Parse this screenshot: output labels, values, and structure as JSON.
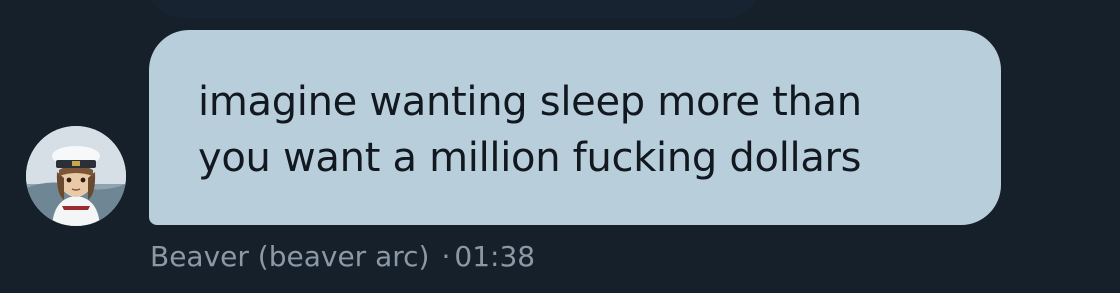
{
  "message": {
    "text": "imagine wanting sleep more than\nyou want a million fucking dollars",
    "sender": "Beaver (beaver arc)",
    "separator": "·",
    "time": "01:38"
  },
  "colors": {
    "background": "#15202b",
    "bubble": "#b9cedb",
    "bubble_text": "#111820",
    "meta_text": "#8b98a5"
  },
  "icons": {
    "avatar": "sailor-girl-avatar"
  }
}
